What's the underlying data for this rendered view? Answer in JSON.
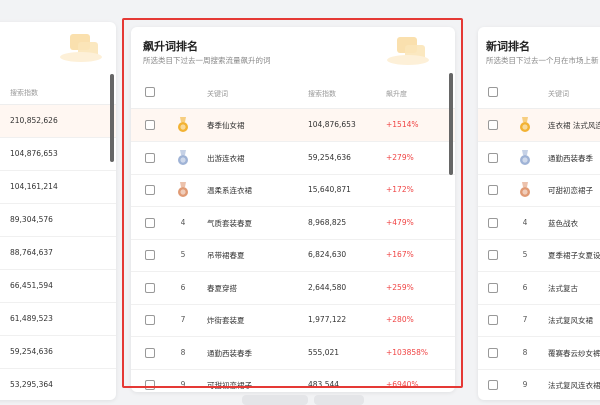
{
  "left_panel": {
    "header": "搜索指数",
    "values": [
      "210,852,626",
      "104,876,653",
      "104,161,214",
      "89,304,576",
      "88,764,637",
      "66,451,594",
      "61,489,523",
      "59,254,636",
      "53,295,364"
    ]
  },
  "middle_panel": {
    "title": "飙升词排名",
    "subtitle": "所选类目下过去一周搜索流量飙升的词",
    "headers": {
      "keyword": "关键词",
      "search_index": "搜索指数",
      "rise": "飙升度"
    },
    "rows": [
      {
        "rank": "1",
        "keyword": "春季仙女裙",
        "index": "104,876,653",
        "rise": "+1514%"
      },
      {
        "rank": "2",
        "keyword": "出游连衣裙",
        "index": "59,254,636",
        "rise": "+279%"
      },
      {
        "rank": "3",
        "keyword": "温柔系连衣裙",
        "index": "15,640,871",
        "rise": "+172%"
      },
      {
        "rank": "4",
        "keyword": "气质套装春夏",
        "index": "8,968,825",
        "rise": "+479%"
      },
      {
        "rank": "5",
        "keyword": "吊带裙春夏",
        "index": "6,824,630",
        "rise": "+167%"
      },
      {
        "rank": "6",
        "keyword": "春夏穿搭",
        "index": "2,644,580",
        "rise": "+259%"
      },
      {
        "rank": "7",
        "keyword": "炸街套装夏",
        "index": "1,977,122",
        "rise": "+280%"
      },
      {
        "rank": "8",
        "keyword": "通勤西装春季",
        "index": "555,021",
        "rise": "+103858%"
      },
      {
        "rank": "9",
        "keyword": "可甜初恋裙子",
        "index": "483,544",
        "rise": "+6940%"
      }
    ]
  },
  "right_panel": {
    "title": "新词排名",
    "subtitle": "所选类目下过去一个月在市场上新",
    "header_keyword": "关键词",
    "rows": [
      {
        "rank": "1",
        "keyword": "连衣裙 法式风连"
      },
      {
        "rank": "2",
        "keyword": "通勤西装春季"
      },
      {
        "rank": "3",
        "keyword": "可甜初恋裙子"
      },
      {
        "rank": "4",
        "keyword": "蓝色战衣"
      },
      {
        "rank": "5",
        "keyword": "夏季裙子女夏设"
      },
      {
        "rank": "6",
        "keyword": "法式复古"
      },
      {
        "rank": "7",
        "keyword": "法式复风女裙"
      },
      {
        "rank": "8",
        "keyword": "覆赛春云纱女裤"
      },
      {
        "rank": "9",
        "keyword": "法式复风连衣裙"
      }
    ]
  },
  "colors": {
    "gold": "#f2b233",
    "silver": "#9fb3d6",
    "bronze": "#e09a74",
    "rise": "#f04444",
    "highlight": "#e53935"
  }
}
